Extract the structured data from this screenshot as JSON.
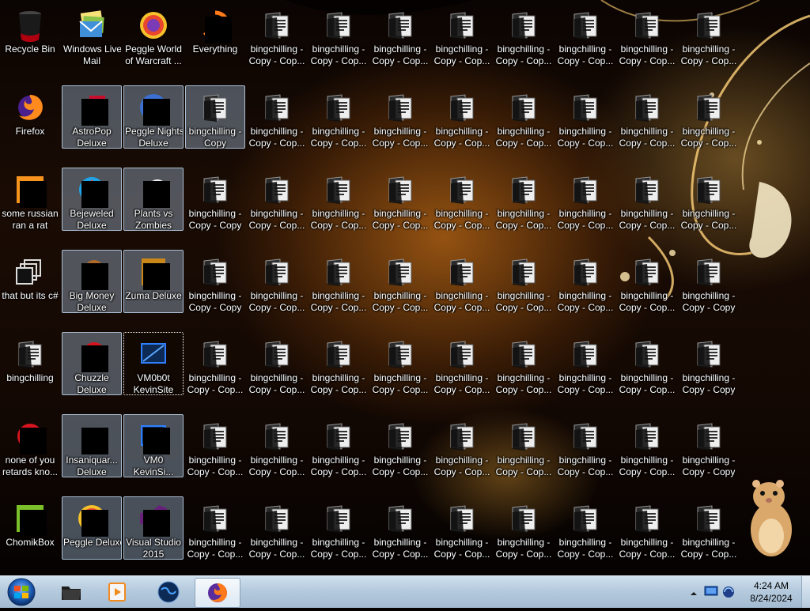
{
  "desktop": {
    "icons": [
      {
        "label": "Recycle Bin",
        "icon": "recycle-bin-icon",
        "col": 0,
        "row": 0,
        "name": "desktop-icon-recycle-bin"
      },
      {
        "label": "Windows Live\nMail",
        "icon": "windows-live-mail-icon",
        "col": 1,
        "row": 0,
        "name": "desktop-icon-windows-live-mail"
      },
      {
        "label": "Peggle World\nof Warcraft ...",
        "icon": "peggle-icon",
        "col": 2,
        "row": 0,
        "name": "desktop-icon-peggle-world-of-warcraft"
      },
      {
        "label": "Everything",
        "icon": "everything-search-icon",
        "col": 3,
        "row": 0,
        "name": "desktop-icon-everything",
        "redacted": true
      },
      {
        "label": "Firefox",
        "icon": "firefox-icon",
        "col": 0,
        "row": 1,
        "name": "desktop-icon-firefox"
      },
      {
        "label": "AstroPop\nDeluxe",
        "icon": "astropop-icon",
        "col": 1,
        "row": 1,
        "name": "desktop-icon-astropop-deluxe",
        "selected": true,
        "redacted": true
      },
      {
        "label": "Peggle Nights\nDeluxe",
        "icon": "peggle-nights-icon",
        "col": 2,
        "row": 1,
        "name": "desktop-icon-peggle-nights-deluxe",
        "selected": true,
        "redacted": true
      },
      {
        "label": "bingchilling -\nCopy",
        "icon": "folder-icon",
        "col": 3,
        "row": 1,
        "name": "desktop-icon-bingchilling-copy",
        "selected": true
      },
      {
        "label": "some russian\nran a rat",
        "icon": "rat-program-icon",
        "col": 0,
        "row": 2,
        "name": "desktop-icon-some-russian-ran-a-rat",
        "redacted": true
      },
      {
        "label": "Bejeweled\nDeluxe",
        "icon": "bejeweled-icon",
        "col": 1,
        "row": 2,
        "name": "desktop-icon-bejeweled-deluxe",
        "selected": true,
        "redacted": true
      },
      {
        "label": "Plants vs\nZombies",
        "icon": "plants-vs-zombies-icon",
        "col": 2,
        "row": 2,
        "name": "desktop-icon-plants-vs-zombies",
        "selected": true,
        "redacted": true
      },
      {
        "label": "bingchilling -\nCopy - Copy",
        "icon": "folder-icon",
        "col": 3,
        "row": 2,
        "name": "desktop-icon-bingchilling-copy-copy"
      },
      {
        "label": "that but its c#",
        "icon": "copy-shortcut-icon",
        "col": 0,
        "row": 3,
        "name": "desktop-icon-that-but-its-csharp"
      },
      {
        "label": "Big Money\nDeluxe",
        "icon": "big-money-icon",
        "col": 1,
        "row": 3,
        "name": "desktop-icon-big-money-deluxe",
        "selected": true,
        "redacted": true
      },
      {
        "label": "Zuma Deluxe",
        "icon": "zuma-icon",
        "col": 2,
        "row": 3,
        "name": "desktop-icon-zuma-deluxe",
        "selected": true,
        "redacted": true
      },
      {
        "label": "bingchilling",
        "icon": "folder-icon",
        "col": 0,
        "row": 4,
        "name": "desktop-icon-bingchilling"
      },
      {
        "label": "Chuzzle\nDeluxe",
        "icon": "chuzzle-icon",
        "col": 1,
        "row": 4,
        "name": "desktop-icon-chuzzle-deluxe",
        "selected": true,
        "redacted": true
      },
      {
        "label": "VM0b0t\nKevinSite",
        "icon": "vm-site-icon",
        "col": 2,
        "row": 4,
        "name": "desktop-icon-vm0b0t-kevinsite",
        "focused": true
      },
      {
        "label": "none of you\nretards kno...",
        "icon": "chrome-like-icon",
        "col": 0,
        "row": 5,
        "name": "desktop-icon-none-of-you",
        "redacted": true
      },
      {
        "label": "Insaniquar...\nDeluxe",
        "icon": "insaniquarium-icon",
        "col": 1,
        "row": 5,
        "name": "desktop-icon-insaniquarium-deluxe",
        "selected": true,
        "redacted": true
      },
      {
        "label": "VM0\nKevinSi...",
        "icon": "vm-site-icon",
        "col": 2,
        "row": 5,
        "name": "desktop-icon-vm0-kevinsite",
        "selected": true,
        "redacted": true
      },
      {
        "label": "ChomikBox",
        "icon": "chomikbox-icon",
        "col": 0,
        "row": 6,
        "name": "desktop-icon-chomikbox",
        "redacted": true
      },
      {
        "label": "Peggle Deluxe",
        "icon": "peggle-icon",
        "col": 1,
        "row": 6,
        "name": "desktop-icon-peggle-deluxe",
        "selected": true,
        "redacted": true
      },
      {
        "label": "Visual Studio\n2015",
        "icon": "visual-studio-icon",
        "col": 2,
        "row": 6,
        "name": "desktop-icon-visual-studio-2015",
        "selected": true,
        "redacted": true
      }
    ],
    "folder_copy_grid": {
      "label_a": "bingchilling -\nCopy - Cop...",
      "label_b": "bingchilling -\nCopy - Copy",
      "rows": [
        {
          "row": 0,
          "from_col": 4,
          "to_col": 11,
          "label": "a"
        },
        {
          "row": 1,
          "from_col": 4,
          "to_col": 11,
          "label": "a"
        },
        {
          "row": 2,
          "from_col": 4,
          "to_col": 11,
          "label": "a"
        },
        {
          "row": 3,
          "from_col": 3,
          "to_col": 11,
          "label": "a"
        },
        {
          "row": 4,
          "from_col": 3,
          "to_col": 11,
          "label": "a"
        },
        {
          "row": 5,
          "from_col": 3,
          "to_col": 11,
          "label": "a"
        },
        {
          "row": 6,
          "from_col": 3,
          "to_col": 11,
          "label": "a"
        }
      ],
      "label_overrides": [
        {
          "row": 3,
          "col": 3,
          "label": "b"
        },
        {
          "row": 3,
          "col": 11,
          "label": "b"
        },
        {
          "row": 4,
          "col": 11,
          "label": "b"
        },
        {
          "row": 5,
          "col": 11,
          "label": "b"
        },
        {
          "row": 6,
          "col": 11,
          "label": "a"
        }
      ]
    }
  },
  "taskbar": {
    "start_button": "windows-orb-icon",
    "pinned": [
      {
        "name": "taskbar-explorer",
        "icon": "folder-icon"
      },
      {
        "name": "taskbar-media-player",
        "icon": "media-player-icon"
      },
      {
        "name": "taskbar-browser-globe",
        "icon": "globe-icon"
      },
      {
        "name": "taskbar-firefox",
        "icon": "firefox-icon",
        "active": true
      }
    ],
    "tray": {
      "time": "4:24 AM",
      "date": "8/24/2024",
      "icons": [
        "show-hidden-icons-icon",
        "action-center-icon",
        "network-icon"
      ]
    }
  },
  "colors": {
    "taskbar": "#b8cde0",
    "selection": "#aecdeb",
    "label_text": "#ffffff"
  }
}
